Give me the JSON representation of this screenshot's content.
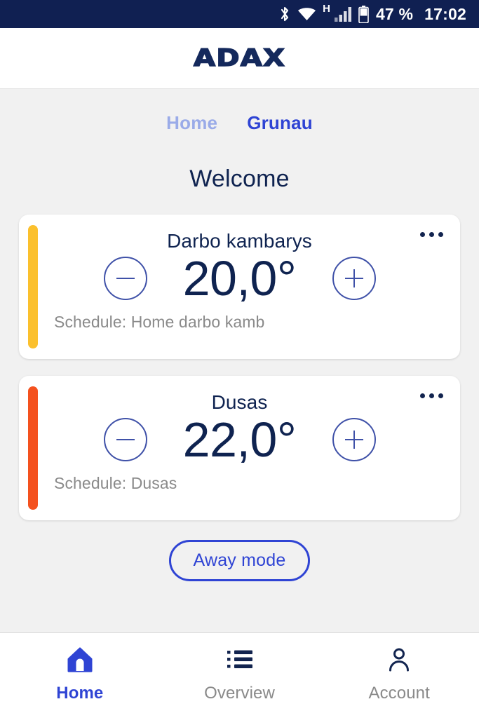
{
  "status_bar": {
    "bluetooth_icon": "bluetooth-icon",
    "wifi_icon": "wifi-icon",
    "network_type": "H",
    "signal_icon": "cellular-signal-icon",
    "battery_icon": "battery-icon",
    "battery_percent": "47 %",
    "clock": "17:02",
    "background_color": "#102052"
  },
  "header": {
    "logo_text": "ADAX",
    "logo_color": "#14295c"
  },
  "breadcrumb": {
    "items": [
      {
        "label": "Home",
        "active": false
      },
      {
        "label": "Grunau",
        "active": true
      }
    ],
    "inactive_color": "#9aabe8",
    "active_color": "#2f44d4"
  },
  "page_title": "Welcome",
  "rooms": [
    {
      "name": "Darbo kambarys",
      "temperature": "20,0°",
      "schedule": "Schedule: Home darbo kamb",
      "status_color": "#fbc02d",
      "decrease_label": "−",
      "increase_label": "+",
      "menu_label": "•••"
    },
    {
      "name": "Dusas",
      "temperature": "22,0°",
      "schedule": "Schedule: Dusas",
      "status_color": "#f4511e",
      "decrease_label": "−",
      "increase_label": "+",
      "menu_label": "•••"
    }
  ],
  "away_mode": {
    "label": "Away mode",
    "color": "#2f44d4"
  },
  "bottom_nav": {
    "items": [
      {
        "label": "Home",
        "icon": "home-icon",
        "active": true
      },
      {
        "label": "Overview",
        "icon": "list-icon",
        "active": false
      },
      {
        "label": "Account",
        "icon": "person-icon",
        "active": false
      }
    ]
  }
}
